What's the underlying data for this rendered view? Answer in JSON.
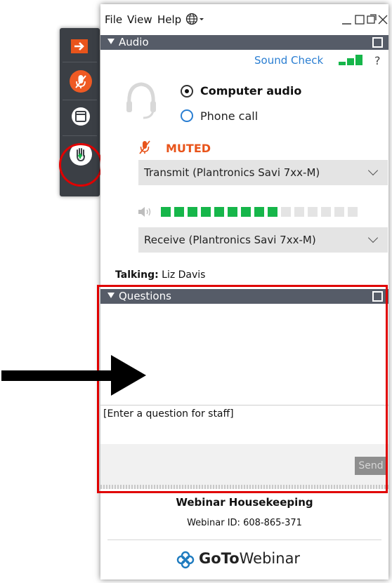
{
  "menu": {
    "file": "File",
    "view": "View",
    "help": "Help"
  },
  "icons": {
    "globe": "globe-icon",
    "minimize": "minimize-icon",
    "restore": "restore-icon",
    "close": "close-icon",
    "popout": "popout-icon",
    "headset": "headset-icon",
    "mic_muted": "muted-microphone-icon",
    "speaker": "speaker-icon",
    "raise_hand": "raise-hand-icon"
  },
  "toolbar": {
    "expand": "expand-arrow-icon",
    "mute": "microphone-mute-icon",
    "screen": "screen-icon",
    "hand": "raise-hand-icon"
  },
  "audio": {
    "header": "Audio",
    "sound_check": "Sound Check",
    "help": "?",
    "computer_audio": "Computer audio",
    "phone_call": "Phone call",
    "selected_mode": "Computer audio",
    "muted": "MUTED",
    "transmit": "Transmit (Plantronics Savi 7xx-M)",
    "receive": "Receive (Plantronics Savi 7xx-M)",
    "volume_level": 0.6
  },
  "talking": {
    "label": "Talking:",
    "name": "Liz Davis"
  },
  "questions": {
    "header": "Questions",
    "placeholder": "[Enter a question for staff]",
    "send": "Send"
  },
  "footer": {
    "title": "Webinar Housekeeping",
    "webinar_id": "Webinar ID: 608-865-371",
    "brand_goto": "GoTo",
    "brand_webinar": "Webinar"
  },
  "colors": {
    "accent_orange": "#e8541b",
    "header_gray": "#565c68",
    "link_blue": "#2a7ed2",
    "level_green": "#16b64a",
    "highlight_red": "#e00000",
    "brand_blue": "#1e7bbf"
  }
}
